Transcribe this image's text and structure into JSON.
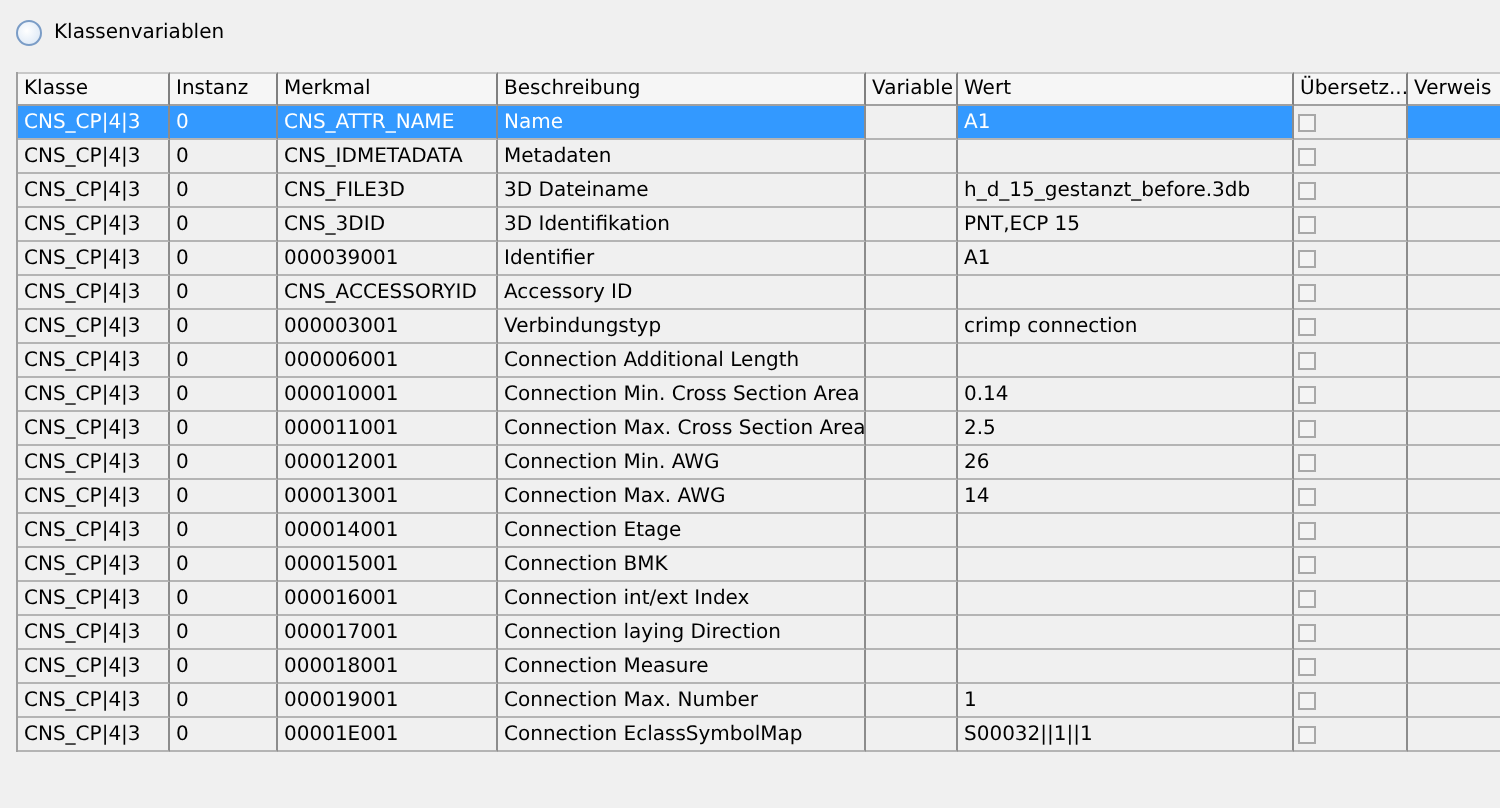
{
  "panel": {
    "title": "Klassenvariablen"
  },
  "table": {
    "columns": [
      "Klasse",
      "Instanz",
      "Merkmal",
      "Beschreibung",
      "Variable",
      "Wert",
      "Übersetz...",
      "Verweis"
    ],
    "rows": [
      {
        "klasse": "CNS_CP|4|3",
        "instanz": "0",
        "merkmal": "CNS_ATTR_NAME",
        "beschreibung": "Name",
        "wert": "A1",
        "translated": false,
        "selected": true
      },
      {
        "klasse": "CNS_CP|4|3",
        "instanz": "0",
        "merkmal": "CNS_IDMETADATA",
        "beschreibung": "Metadaten",
        "translated": false,
        "selected": false
      },
      {
        "klasse": "CNS_CP|4|3",
        "instanz": "0",
        "merkmal": "CNS_FILE3D",
        "beschreibung": "3D Dateiname",
        "wert": "h_d_15_gestanzt_before.3db",
        "translated": false,
        "selected": false
      },
      {
        "klasse": "CNS_CP|4|3",
        "instanz": "0",
        "merkmal": "CNS_3DID",
        "beschreibung": "3D Identifikation",
        "wert": "PNT,ECP 15",
        "translated": false,
        "selected": false
      },
      {
        "klasse": "CNS_CP|4|3",
        "instanz": "0",
        "merkmal": "000039001",
        "beschreibung": "Identifier",
        "wert": "A1",
        "translated": false,
        "selected": false
      },
      {
        "klasse": "CNS_CP|4|3",
        "instanz": "0",
        "merkmal": "CNS_ACCESSORYID",
        "beschreibung": "Accessory ID",
        "translated": false,
        "selected": false
      },
      {
        "klasse": "CNS_CP|4|3",
        "instanz": "0",
        "merkmal": "000003001",
        "beschreibung": "Verbindungstyp",
        "wert": "crimp connection",
        "translated": false,
        "selected": false
      },
      {
        "klasse": "CNS_CP|4|3",
        "instanz": "0",
        "merkmal": "000006001",
        "beschreibung": "Connection Additional Length",
        "translated": false,
        "selected": false
      },
      {
        "klasse": "CNS_CP|4|3",
        "instanz": "0",
        "merkmal": "000010001",
        "beschreibung": "Connection Min. Cross Section Area",
        "wert": "0.14",
        "translated": false,
        "selected": false
      },
      {
        "klasse": "CNS_CP|4|3",
        "instanz": "0",
        "merkmal": "000011001",
        "beschreibung": "Connection Max. Cross Section Area",
        "wert": "2.5",
        "translated": false,
        "selected": false
      },
      {
        "klasse": "CNS_CP|4|3",
        "instanz": "0",
        "merkmal": "000012001",
        "beschreibung": "Connection Min. AWG",
        "wert": "26",
        "translated": false,
        "selected": false
      },
      {
        "klasse": "CNS_CP|4|3",
        "instanz": "0",
        "merkmal": "000013001",
        "beschreibung": "Connection Max. AWG",
        "wert": "14",
        "translated": false,
        "selected": false
      },
      {
        "klasse": "CNS_CP|4|3",
        "instanz": "0",
        "merkmal": "000014001",
        "beschreibung": "Connection Etage",
        "translated": false,
        "selected": false
      },
      {
        "klasse": "CNS_CP|4|3",
        "instanz": "0",
        "merkmal": "000015001",
        "beschreibung": "Connection BMK",
        "translated": false,
        "selected": false
      },
      {
        "klasse": "CNS_CP|4|3",
        "instanz": "0",
        "merkmal": "000016001",
        "beschreibung": "Connection int/ext Index",
        "translated": false,
        "selected": false
      },
      {
        "klasse": "CNS_CP|4|3",
        "instanz": "0",
        "merkmal": "000017001",
        "beschreibung": "Connection laying Direction",
        "translated": false,
        "selected": false
      },
      {
        "klasse": "CNS_CP|4|3",
        "instanz": "0",
        "merkmal": "000018001",
        "beschreibung": "Connection Measure",
        "translated": false,
        "selected": false
      },
      {
        "klasse": "CNS_CP|4|3",
        "instanz": "0",
        "merkmal": "000019001",
        "beschreibung": "Connection Max. Number",
        "wert": "1",
        "translated": false,
        "selected": false
      },
      {
        "klasse": "CNS_CP|4|3",
        "instanz": "0",
        "merkmal": "00001E001",
        "beschreibung": "Connection EclassSymbolMap",
        "wert": "S00032||1||1",
        "translated": false,
        "selected": false
      }
    ]
  }
}
